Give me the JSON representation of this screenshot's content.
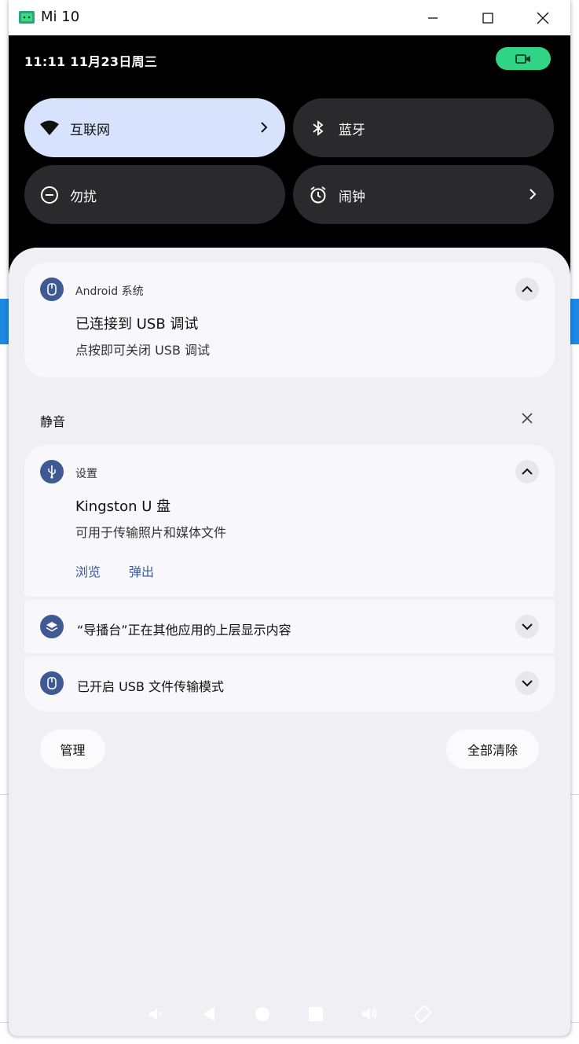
{
  "window": {
    "title": "Mi 10"
  },
  "status": {
    "datetime": "11:11 11月23日周三"
  },
  "tiles": [
    {
      "label": "互联网"
    },
    {
      "label": "蓝牙"
    },
    {
      "label": "勿扰"
    },
    {
      "label": "闹钟"
    }
  ],
  "notifications": {
    "usb_debug": {
      "app": "Android 系统",
      "title": "已连接到 USB 调试",
      "text": "点按即可关闭 USB 调试"
    },
    "silent_header": "静音",
    "usb_drive": {
      "app": "设置",
      "title": "Kingston U 盘",
      "text": "可用于传输照片和媒体文件",
      "actions": [
        "浏览",
        "弹出"
      ]
    },
    "overlay": {
      "text": "“导播台”正在其他应用的上层显示内容"
    },
    "usb_transfer": {
      "text": "已开启 USB 文件传输模式"
    }
  },
  "footer": {
    "manage": "管理",
    "clear_all": "全部清除"
  },
  "colors": {
    "accent": "#3f5a93",
    "active_tile": "#d7e3fc",
    "record": "#2fd484"
  }
}
